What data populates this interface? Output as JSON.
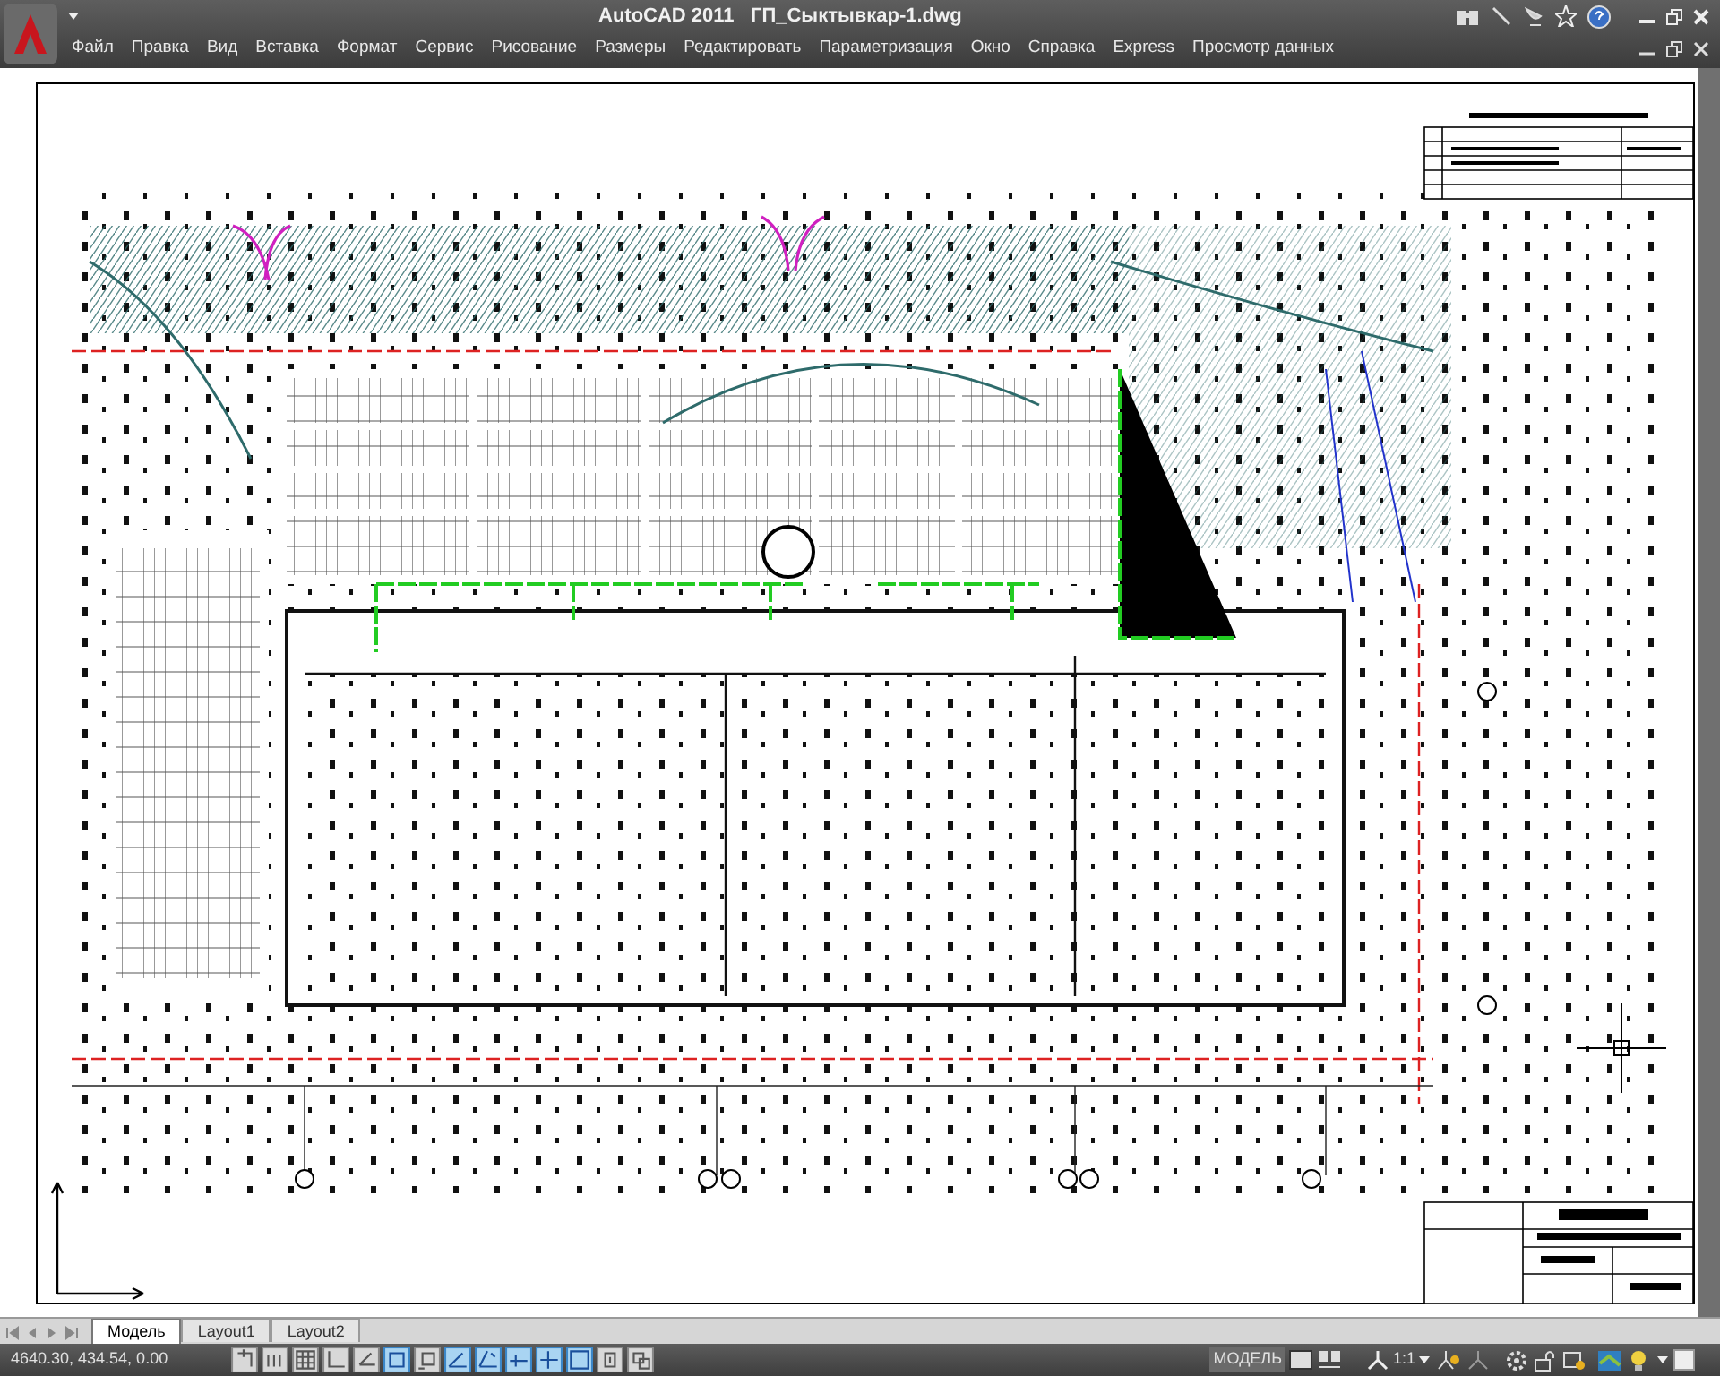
{
  "window": {
    "title": "AutoCAD 2011   ГП_Сыктывкар-1.dwg"
  },
  "menu": [
    "Файл",
    "Правка",
    "Вид",
    "Вставка",
    "Формат",
    "Сервис",
    "Рисование",
    "Размеры",
    "Редактировать",
    "Параметризация",
    "Окно",
    "Справка",
    "Express",
    "Просмотр данных"
  ],
  "tabs": [
    {
      "label": "Модель",
      "selected": true
    },
    {
      "label": "Layout1",
      "selected": false
    },
    {
      "label": "Layout2",
      "selected": false
    }
  ],
  "status_bar": {
    "coordinates": "4640.30, 434.54, 0.00",
    "toggles": [
      {
        "on": false
      },
      {
        "on": false
      },
      {
        "on": false
      },
      {
        "on": false
      },
      {
        "on": false
      },
      {
        "on": true
      },
      {
        "on": false
      },
      {
        "on": true
      },
      {
        "on": true
      },
      {
        "on": true
      },
      {
        "on": true
      },
      {
        "on": true
      },
      {
        "on": false
      },
      {
        "on": false
      }
    ],
    "space": "МОДЕЛЬ",
    "annotation_scale": "1:1"
  }
}
